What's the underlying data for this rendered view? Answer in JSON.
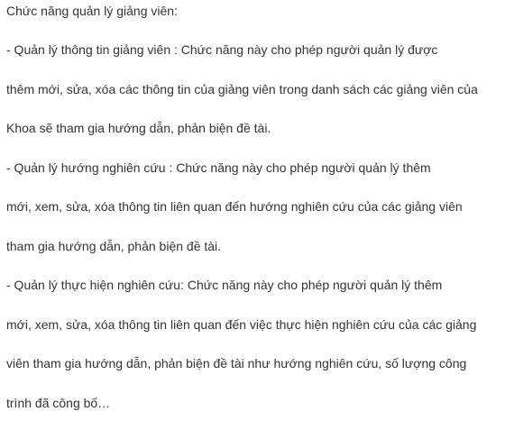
{
  "document": {
    "lines": [
      "Chức năng quản lý giảng viên:",
      "- Quản lý thông tin giảng viên : Chức năng này cho phép người quản lý được",
      "thêm mới, sửa, xóa các thông tin của giảng viên trong danh sách các giảng viên của",
      "Khoa sẽ tham gia hướng dẫn, phản biện đề tài.",
      "- Quản lý hướng nghiên cứu : Chức năng này cho phép người quản lý thêm",
      "mới, xem, sửa, xóa thông tin liên quan đến hướng nghiên cứu của các giảng viên",
      "tham gia hướng dẫn, phản biện đề tài.",
      "- Quản lý thực hiện nghiên cứu: Chức năng này cho phép người quản lý thêm",
      "mới, xem, sửa, xóa thông tin liên quan đến việc thực hiện nghiên cứu của các giảng",
      "viên tham gia hướng dẫn, phản biện đề tài như hướng nghiên cứu, số lượng công",
      "trình đã công bố…"
    ]
  }
}
